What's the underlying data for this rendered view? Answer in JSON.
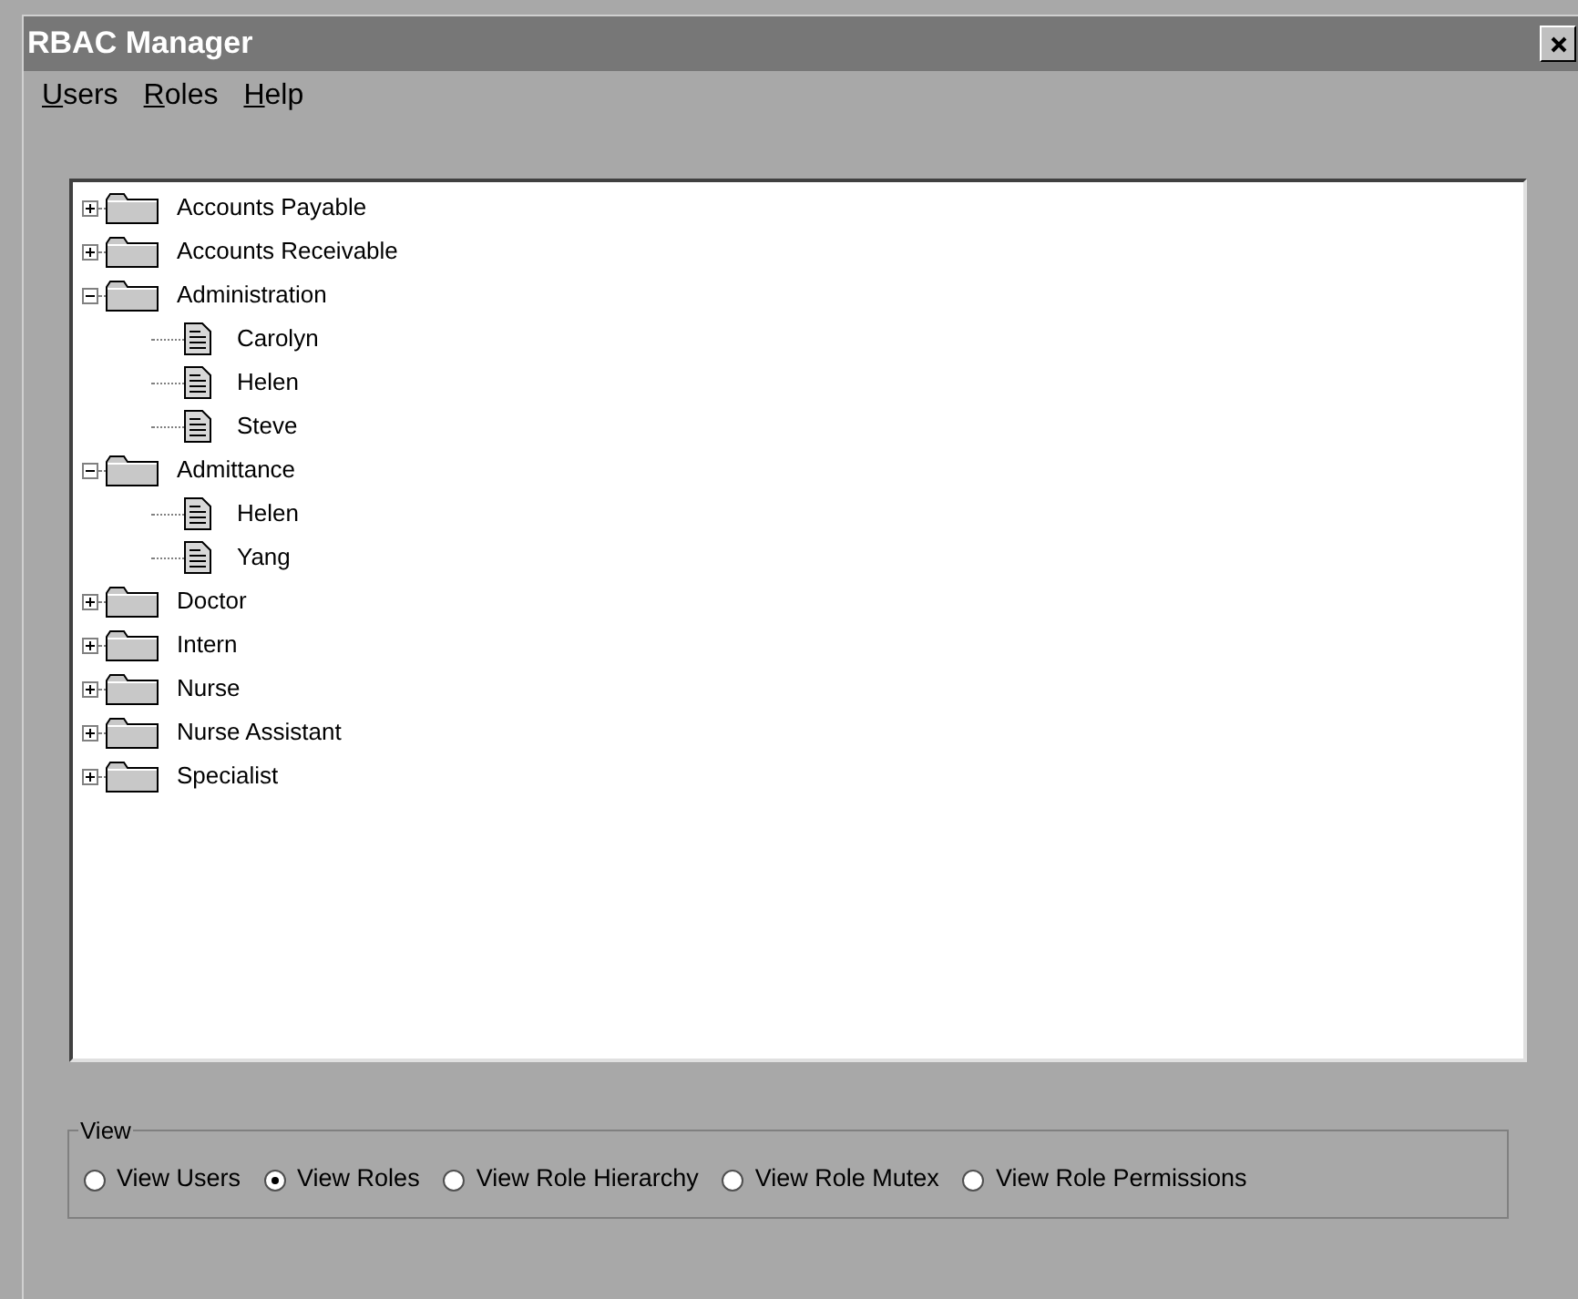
{
  "window": {
    "title": "RBAC Manager"
  },
  "menu": [
    {
      "label": "Users"
    },
    {
      "label": "Roles"
    },
    {
      "label": "Help"
    }
  ],
  "tree": [
    {
      "label": "Accounts Payable",
      "expanded": false
    },
    {
      "label": "Accounts Receivable",
      "expanded": false
    },
    {
      "label": "Administration",
      "expanded": true,
      "children": [
        {
          "label": "Carolyn"
        },
        {
          "label": "Helen"
        },
        {
          "label": "Steve"
        }
      ]
    },
    {
      "label": "Admittance",
      "expanded": true,
      "children": [
        {
          "label": "Helen"
        },
        {
          "label": "Yang"
        }
      ]
    },
    {
      "label": "Doctor",
      "expanded": false
    },
    {
      "label": "Intern",
      "expanded": false
    },
    {
      "label": "Nurse",
      "expanded": false
    },
    {
      "label": "Nurse Assistant",
      "expanded": false
    },
    {
      "label": "Specialist",
      "expanded": false
    }
  ],
  "view_group": {
    "title": "View",
    "options": [
      {
        "label": "View Users",
        "selected": false
      },
      {
        "label": "View Roles",
        "selected": true
      },
      {
        "label": "View Role Hierarchy",
        "selected": false
      },
      {
        "label": "View Role Mutex",
        "selected": false
      },
      {
        "label": "View Role Permissions",
        "selected": false
      }
    ]
  }
}
